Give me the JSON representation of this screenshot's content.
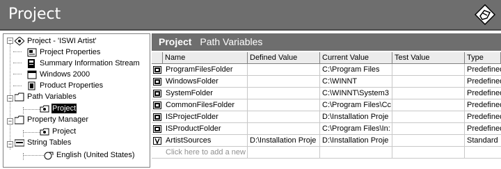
{
  "window": {
    "title": "Project"
  },
  "tree": {
    "items": [
      {
        "label": "Project - 'ISWI Artist'",
        "icon": "project-icon"
      },
      {
        "label": "Project Properties",
        "icon": "properties-icon"
      },
      {
        "label": "Summary Information Stream",
        "icon": "summary-icon"
      },
      {
        "label": "Windows 2000",
        "icon": "windows-icon"
      },
      {
        "label": "Product Properties",
        "icon": "product-icon"
      },
      {
        "label": "Path Variables",
        "icon": "folder-icon"
      },
      {
        "label": "Project",
        "icon": "path-item-icon",
        "selected": true
      },
      {
        "label": "Property Manager",
        "icon": "folder-icon"
      },
      {
        "label": "Project",
        "icon": "path-item-icon"
      },
      {
        "label": "String Tables",
        "icon": "abc-icon"
      },
      {
        "label": "English (United States)",
        "icon": "language-icon"
      }
    ]
  },
  "main": {
    "header_title": "Project",
    "header_subtitle": "Path Variables",
    "columns": [
      "Name",
      "Defined Value",
      "Current Value",
      "Test Value",
      "Type"
    ],
    "rows": [
      {
        "icon": "predefined-icon",
        "name": "ProgramFilesFolder",
        "defined": "",
        "current": "C:\\Program Files",
        "test": "",
        "type": "Predefined"
      },
      {
        "icon": "predefined-icon",
        "name": "WindowsFolder",
        "defined": "",
        "current": "C:\\WINNT",
        "test": "",
        "type": "Predefined"
      },
      {
        "icon": "predefined-icon",
        "name": "SystemFolder",
        "defined": "",
        "current": "C:\\WINNT\\System3",
        "test": "",
        "type": "Predefined"
      },
      {
        "icon": "predefined-icon",
        "name": "CommonFilesFolder",
        "defined": "",
        "current": "C:\\Program Files\\Cc",
        "test": "",
        "type": "Predefined"
      },
      {
        "icon": "predefined-icon",
        "name": "ISProjectFolder",
        "defined": "",
        "current": "D:\\Installation Proje",
        "test": "",
        "type": "Predefined"
      },
      {
        "icon": "predefined-icon",
        "name": "ISProductFolder",
        "defined": "",
        "current": "C:\\Program Files\\In:",
        "test": "",
        "type": "Predefined"
      },
      {
        "icon": "standard-icon",
        "name": "ArtistSources",
        "defined": "D:\\Installation Proje",
        "current": "D:\\Installation Proje",
        "test": "",
        "type": "Standard"
      }
    ],
    "add_row_placeholder": "Click here to add a new"
  }
}
